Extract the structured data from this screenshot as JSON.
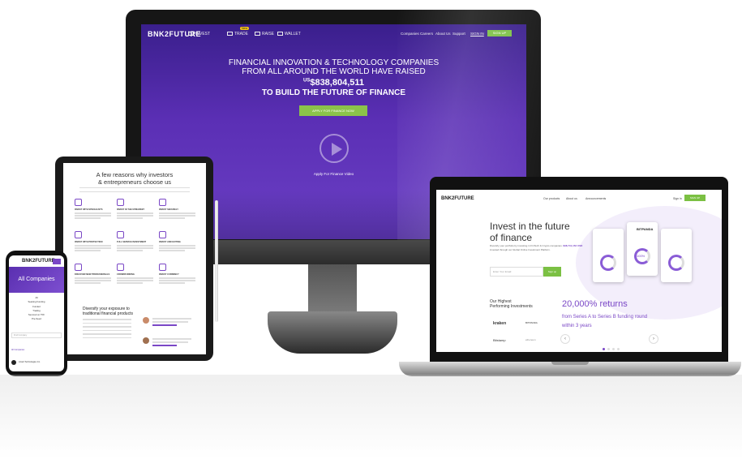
{
  "monitor": {
    "logo": "BNK2FUTURE",
    "nav_left": [
      {
        "label": "INVEST",
        "icon": "wallet-icon"
      },
      {
        "label": "TRADE",
        "icon": "exchange-icon",
        "badge": "New"
      },
      {
        "label": "RAISE",
        "icon": "chart-icon"
      },
      {
        "label": "WALLET",
        "icon": "wallet-box-icon"
      }
    ],
    "nav_right": [
      "Companies",
      "Careers",
      "About Us",
      "Support",
      "SIGN IN",
      "SIGN UP"
    ],
    "headline_line1": "FINANCIAL INNOVATION & TECHNOLOGY COMPANIES",
    "headline_line2": "FROM ALL AROUND THE WORLD HAVE RAISED",
    "amount_prefix": "US",
    "amount": "$838,804,511",
    "tagline": "TO BUILD THE FUTURE OF FINANCE",
    "apply_button": "APPLY FOR FINANCE NOW",
    "video_label": "Apply For Finance Video"
  },
  "tablet": {
    "title_line1": "A few reasons why investors",
    "title_line2": "& entrepreneurs choose us",
    "features": [
      "INVEST WITH SPECIALISTS",
      "INVEST IN THE UPMARKET",
      "INVEST SECURELY",
      "INVEST WITH PROTECTION",
      "FULL SERVICE INVESTMENT",
      "INVEST AND EXITING",
      "DISCOVER NEW PROFESSIONALS",
      "CROWDFUNDING",
      "INVEST CURRENCY"
    ],
    "diversify_line1": "Diversify your exposure to",
    "diversify_line2": "traditional financial products"
  },
  "phone": {
    "logo": "BNK2FUTURE",
    "banner": "All Companies",
    "list": [
      "All",
      "Seeking Funding",
      "Funded",
      "Trading",
      "Secured on TFF",
      "Pre-Seed"
    ],
    "search_placeholder": "Find Company",
    "label": "All Companies",
    "item": "Lizard Technologies Inc."
  },
  "laptop": {
    "logo": "BNK2FUTURE",
    "nav": [
      "Our products",
      "About us",
      "Announcements",
      "Sign in",
      "SIGN UP"
    ],
    "headline_line1": "Invest in the future",
    "headline_line2": "of finance",
    "desc_line1": "Diversify your portfolio by investing in FinTech & Crypto companies.",
    "desc_amount": "$38,741,153 USD",
    "desc_line2": "invested through our Global Online Investment Platform.",
    "email_placeholder": "Enter Your Email",
    "signup_button": "Sign up",
    "highest_line1": "Our Highest",
    "highest_line2": "Performing Investments",
    "returns": "20,000% returns",
    "returns_sub_line1": "from Series A to Series B funding round",
    "returns_sub_line2": "within 3 years",
    "brands": [
      "kraken",
      "BITPANDA",
      "Bitstamp",
      "ethereum"
    ],
    "card_value": "100%"
  },
  "colors": {
    "purple": "#6a3fc4",
    "green": "#8bc34a",
    "dark": "#161616"
  }
}
